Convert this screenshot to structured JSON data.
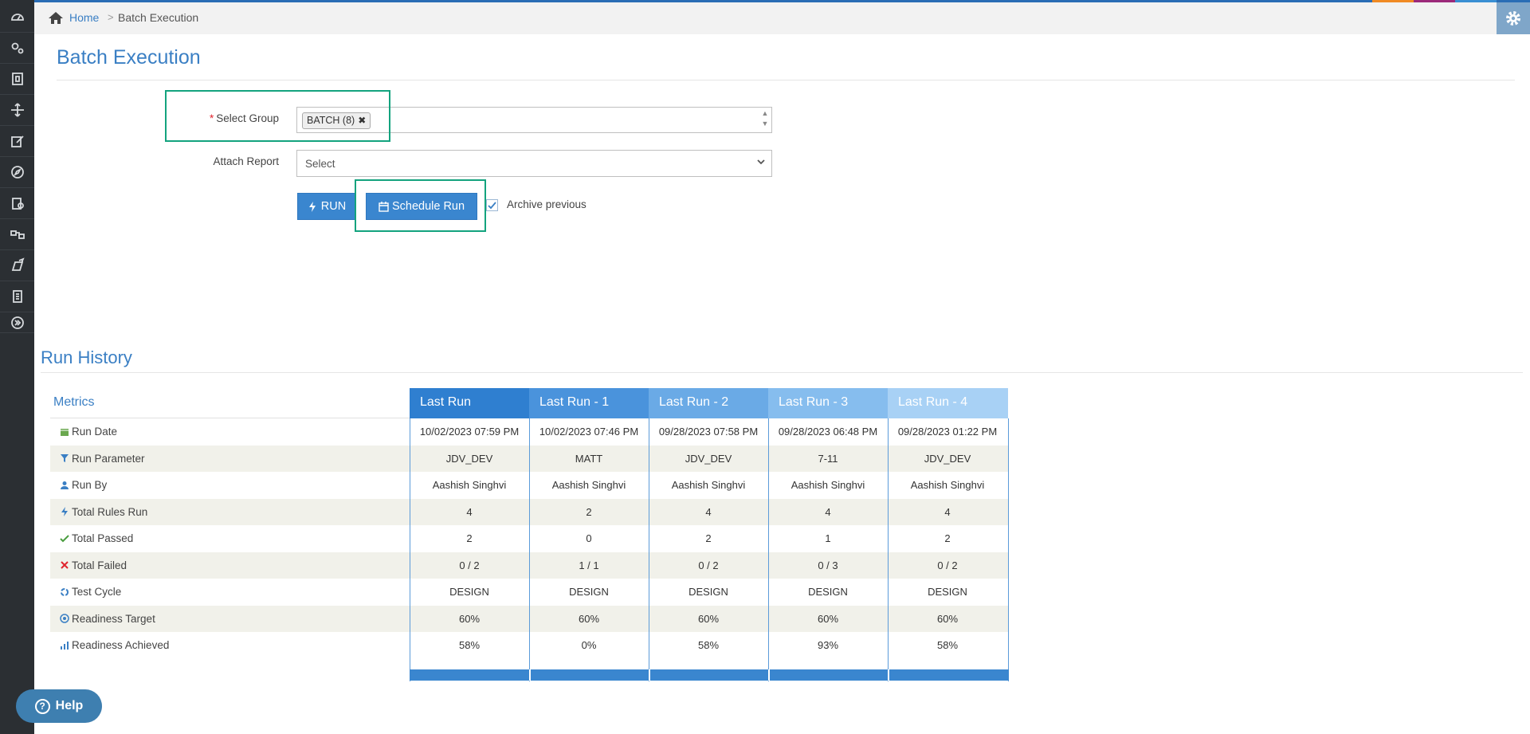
{
  "breadcrumb": {
    "home": "Home",
    "separator": ">",
    "current": "Batch Execution"
  },
  "page": {
    "title": "Batch Execution"
  },
  "sidebar": {
    "items": [
      {
        "icon": "dashboard-icon"
      },
      {
        "icon": "settings-cogs-icon"
      },
      {
        "icon": "database-icon"
      },
      {
        "icon": "move-icon"
      },
      {
        "icon": "edit-icon"
      },
      {
        "icon": "compass-icon"
      },
      {
        "icon": "clipboard-gear-icon"
      },
      {
        "icon": "workflow-icon"
      },
      {
        "icon": "export-icon"
      },
      {
        "icon": "checklist-icon"
      },
      {
        "icon": "expand-icon"
      }
    ]
  },
  "form": {
    "select_group_label": "Select Group",
    "required_mark": "*",
    "selected_tag": "BATCH (8)",
    "attach_report_label": "Attach Report",
    "attach_report_value": "Select",
    "run_button": "RUN",
    "schedule_button": "Schedule Run",
    "archive_label": "Archive previous",
    "archive_checked": true
  },
  "history": {
    "title": "Run History",
    "metrics_header": "Metrics",
    "columns": [
      "Last Run",
      "Last Run - 1",
      "Last Run - 2",
      "Last Run - 3",
      "Last Run - 4"
    ],
    "column_colors": [
      "#2f7fd0",
      "#4a93dc",
      "#6aaae6",
      "#86bdee",
      "#a8d1f5"
    ],
    "rows": [
      {
        "label": "Run Date",
        "icon": "calendar-icon",
        "values": [
          "10/02/2023 07:59 PM",
          "10/02/2023 07:46 PM",
          "09/28/2023 07:58 PM",
          "09/28/2023 06:48 PM",
          "09/28/2023 01:22 PM"
        ]
      },
      {
        "label": "Run Parameter",
        "icon": "filter-icon",
        "values": [
          "JDV_DEV",
          "MATT",
          "JDV_DEV",
          "7-11",
          "JDV_DEV"
        ]
      },
      {
        "label": "Run By",
        "icon": "user-icon",
        "values": [
          "Aashish Singhvi",
          "Aashish Singhvi",
          "Aashish Singhvi",
          "Aashish Singhvi",
          "Aashish Singhvi"
        ]
      },
      {
        "label": "Total Rules Run",
        "icon": "bolt-icon",
        "values": [
          "4",
          "2",
          "4",
          "4",
          "4"
        ]
      },
      {
        "label": "Total Passed",
        "icon": "check-icon",
        "values": [
          "2",
          "0",
          "2",
          "1",
          "2"
        ]
      },
      {
        "label": "Total Failed",
        "icon": "x-icon",
        "values": [
          "0 / 2",
          "1 / 1",
          "0 / 2",
          "0 / 3",
          "0 / 2"
        ]
      },
      {
        "label": "Test Cycle",
        "icon": "cycle-icon",
        "values": [
          "DESIGN",
          "DESIGN",
          "DESIGN",
          "DESIGN",
          "DESIGN"
        ]
      },
      {
        "label": "Readiness Target",
        "icon": "target-icon",
        "values": [
          "60%",
          "60%",
          "60%",
          "60%",
          "60%"
        ]
      },
      {
        "label": "Readiness Achieved",
        "icon": "chart-icon",
        "values": [
          "58%",
          "0%",
          "58%",
          "93%",
          "58%"
        ]
      }
    ]
  },
  "help": {
    "label": "Help"
  }
}
